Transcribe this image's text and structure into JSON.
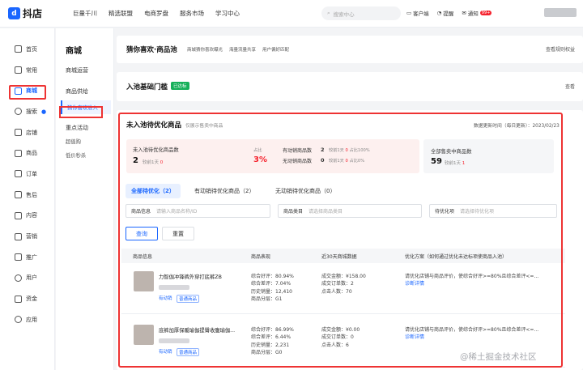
{
  "brand": "抖店",
  "topnav": [
    "巨量千川",
    "精选联盟",
    "电商罗盘",
    "服务市场",
    "学习中心"
  ],
  "search_placeholder": "搜索中心",
  "topright": {
    "cs": "客户端",
    "remind": "提醒",
    "notice": "通知",
    "notice_count": "99+"
  },
  "side": [
    "首页",
    "常用",
    "商城",
    "搜索",
    "店铺",
    "商品",
    "订单",
    "售后",
    "内容",
    "营销",
    "推广",
    "用户",
    "资金",
    "应用"
  ],
  "sub": {
    "title": "商城",
    "g1": "商城运营",
    "g2": "商品供给",
    "active": "猜你喜欢准入",
    "g3": "重点活动",
    "i1": "超值购",
    "i2": "低价秒杀"
  },
  "pool": {
    "title": "猜你喜欢·商品池",
    "tags": [
      "商城猜你喜欢曝光",
      "海量流量共享",
      "用户偏好匹配"
    ],
    "rule": "查看规则权益"
  },
  "threshold": {
    "title": "入池基础门槛",
    "badge": "已达标",
    "view": "查看"
  },
  "main": {
    "title": "未入池待优化商品",
    "hint": "仅展示售卖中商品",
    "update": "数据更新时间（每日更新）：2023/02/23"
  },
  "dash": {
    "l1": "未入池待优化商品数",
    "v1": "2",
    "cmp1": "较前1天",
    "c1": "0",
    "share_label": "占比",
    "share": "3%",
    "a1": "有动销商品数",
    "av1": "2",
    "ac1": "0",
    "ap1": "100%",
    "a2": "无动销商品数",
    "av2": "0",
    "ac2": "0",
    "ap2": "0%",
    "r1": "全部售卖中商品数",
    "rv1": "59",
    "rc1": "1"
  },
  "tabs": [
    "全部待优化（2）",
    "有动销待优化商品（2）",
    "无动销待优化商品（0）"
  ],
  "filters": {
    "f1": "商品信息",
    "p1": "请输入商品名称/ID",
    "f2": "商品类目",
    "p2": "请选择商品类目",
    "f3": "待优化项",
    "p3": "请选择待优化项"
  },
  "buttons": {
    "query": "查询",
    "reset": "重置"
  },
  "table": {
    "h1": "商品信息",
    "h2": "商品表现",
    "h3": "近30天商城数据",
    "h4": "优化方案（如何通过优化未达标项使商品入池）",
    "tag1": "有动销",
    "tag2": "普通商品",
    "rows": [
      {
        "name": "力智伽冲锋裤外穿打底裤ZB",
        "perf": [
          "综合好评：80.94%",
          "综合差评：7.04%",
          "历史销量：12,410",
          "商品分层：G1"
        ],
        "sales": [
          "成交金额：¥158.00",
          "成交订单数：2",
          "点击人数：70"
        ],
        "plan": "请优化店铺与商品评价，使综合好评>=80%且综合差评<=...",
        "detail": "诊断详情"
      },
      {
        "name": "底裤加厚保暖瑜伽提臀收腹瑜伽...",
        "perf": [
          "综合好评：86.99%",
          "综合差评：6.44%",
          "历史销量：2,231",
          "商品分层：G0"
        ],
        "sales": [
          "成交金额：¥0.00",
          "成交订单数：0",
          "点击人数：6"
        ],
        "plan": "请优化店铺与商品评价，使综合好评>=80%且综合差评<=...",
        "detail": "诊断详情"
      }
    ]
  },
  "watermark": "@稀土掘金技术社区"
}
